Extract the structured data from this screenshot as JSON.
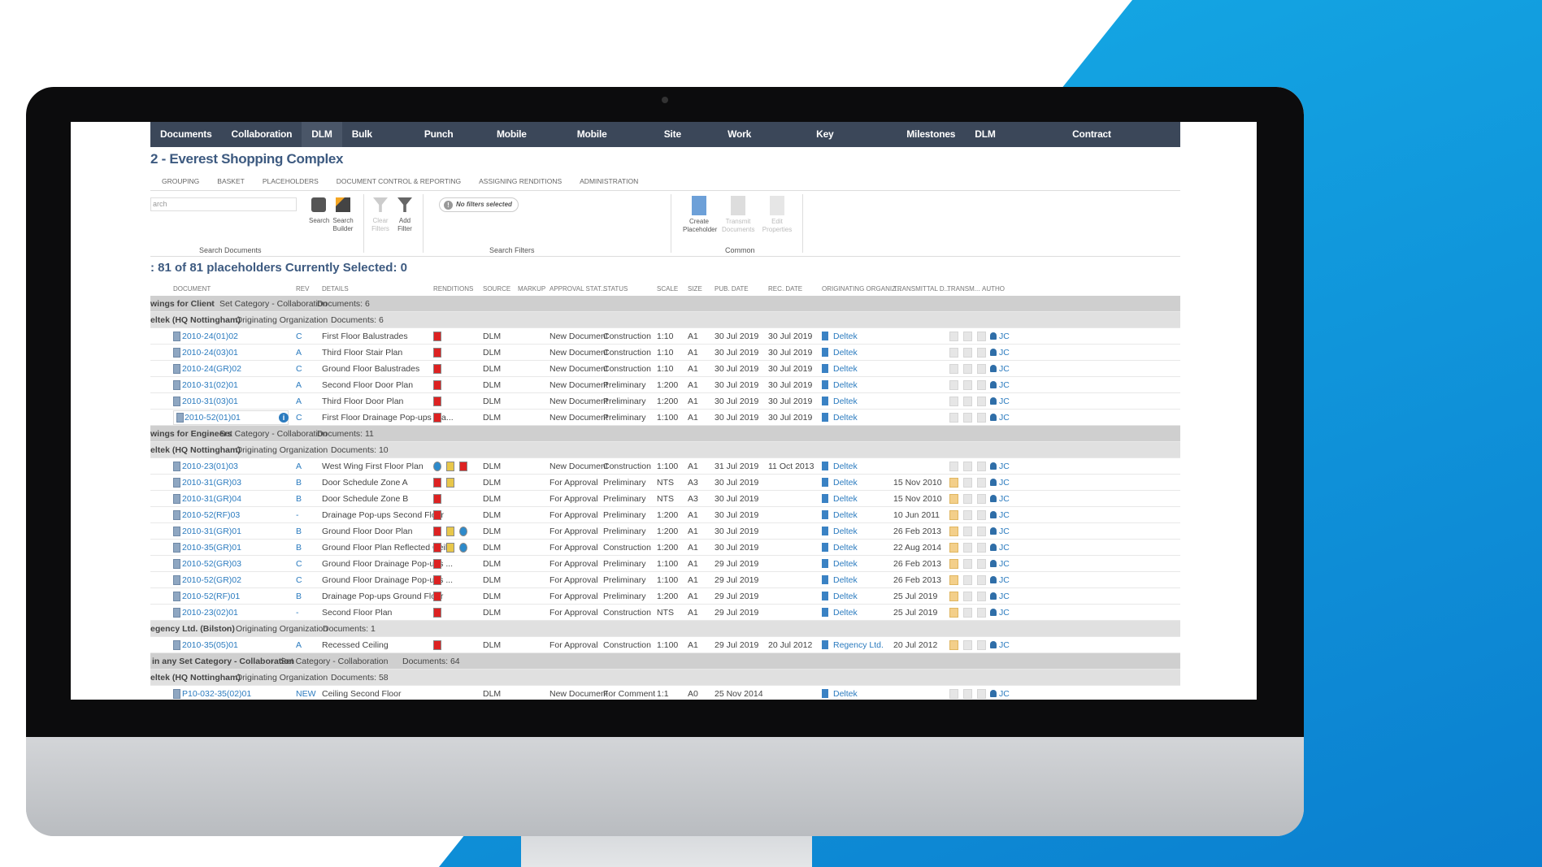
{
  "nav": [
    "Documents",
    "Collaboration",
    "DLM",
    "Bulk Revise",
    "Punch Lists",
    "Mobile Forms",
    "Mobile Reports",
    "Site Visits",
    "Work Packages",
    "Key Documents",
    "Milestones",
    "DLM Transmittals",
    "Contract Management"
  ],
  "nav_active": "DLM",
  "title": "2 - Everest Shopping Complex",
  "subtabs": [
    "GROUPING",
    "BASKET",
    "PLACEHOLDERS",
    "DOCUMENT CONTROL & REPORTING",
    "ASSIGNING RENDITIONS",
    "ADMINISTRATION"
  ],
  "ribbon": {
    "search_placeholder": "arch",
    "search": "Search",
    "search_builder": "Search Builder",
    "clear_filters": "Clear Filters",
    "add_filter": "Add Filter",
    "no_filters": "No filters selected",
    "create_placeholder": "Create Placeholder",
    "transmit_documents": "Transmit Documents",
    "edit_properties": "Edit Properties",
    "group_search": "Search Documents",
    "group_filters": "Search Filters",
    "group_common": "Common"
  },
  "count": ": 81 of 81 placeholders Currently Selected: 0",
  "headers": [
    "DOCUMENT",
    "REV",
    "DETAILS",
    "RENDITIONS",
    "SOURCE",
    "MARKUP",
    "APPROVAL STAT...",
    "STATUS",
    "SCALE",
    "SIZE",
    "PUB. DATE",
    "REC. DATE",
    "ORIGINATING ORGANIZ...",
    "TRANSMITTAL D...",
    "TRANSM...",
    "AUTHO"
  ],
  "colors": {
    "nav": "#3b4759",
    "title": "#3d5a80",
    "link": "#2b7bbf",
    "blue_bg": "#17b3ea"
  },
  "rows": [
    {
      "type": "g1",
      "name": "wings for Client",
      "kind": "Set Category - Collaboration",
      "docs": "Documents: 6"
    },
    {
      "type": "g2",
      "name": "eltek (HQ Nottingham)",
      "kind": "Originating Organization",
      "docs": "Documents: 6"
    },
    {
      "type": "d",
      "doc": "2010-24(01)02",
      "rev": "C",
      "details": "First Floor Balustrades",
      "rend": [
        "pdf"
      ],
      "source": "DLM",
      "approval": "New Document",
      "status": "Construction",
      "scale": "1:10",
      "size": "A1",
      "pub": "30 Jul 2019",
      "rec": "30 Jul 2019",
      "org": "Deltek",
      "trans": "",
      "sent": false,
      "author": "JC"
    },
    {
      "type": "d",
      "doc": "2010-24(03)01",
      "rev": "A",
      "details": "Third Floor Stair Plan",
      "rend": [
        "pdf"
      ],
      "source": "DLM",
      "approval": "New Document",
      "status": "Construction",
      "scale": "1:10",
      "size": "A1",
      "pub": "30 Jul 2019",
      "rec": "30 Jul 2019",
      "org": "Deltek",
      "trans": "",
      "sent": false,
      "author": "JC"
    },
    {
      "type": "d",
      "doc": "2010-24(GR)02",
      "rev": "C",
      "details": "Ground Floor Balustrades",
      "rend": [
        "pdf"
      ],
      "source": "DLM",
      "approval": "New Document",
      "status": "Construction",
      "scale": "1:10",
      "size": "A1",
      "pub": "30 Jul 2019",
      "rec": "30 Jul 2019",
      "org": "Deltek",
      "trans": "",
      "sent": false,
      "author": "JC"
    },
    {
      "type": "d",
      "doc": "2010-31(02)01",
      "rev": "A",
      "details": "Second Floor Door Plan",
      "rend": [
        "pdf"
      ],
      "source": "DLM",
      "approval": "New Document",
      "status": "Preliminary",
      "scale": "1:200",
      "size": "A1",
      "pub": "30 Jul 2019",
      "rec": "30 Jul 2019",
      "org": "Deltek",
      "trans": "",
      "sent": false,
      "author": "JC"
    },
    {
      "type": "d",
      "doc": "2010-31(03)01",
      "rev": "A",
      "details": "Third Floor Door Plan",
      "rend": [
        "pdf"
      ],
      "source": "DLM",
      "approval": "New Document",
      "status": "Preliminary",
      "scale": "1:200",
      "size": "A1",
      "pub": "30 Jul 2019",
      "rec": "30 Jul 2019",
      "org": "Deltek",
      "trans": "",
      "sent": false,
      "author": "JC"
    },
    {
      "type": "d",
      "doc": "2010-52(01)01",
      "rev": "C",
      "details": "First Floor Drainage Pop-ups Pla...",
      "rend": [
        "pdf"
      ],
      "source": "DLM",
      "approval": "New Document",
      "status": "Preliminary",
      "scale": "1:100",
      "size": "A1",
      "pub": "30 Jul 2019",
      "rec": "30 Jul 2019",
      "org": "Deltek",
      "trans": "",
      "sent": false,
      "author": "JC",
      "selected": true
    },
    {
      "type": "g1",
      "name": "wings for Engineers",
      "kind": "Set Category - Collaboration",
      "docs": "Documents: 11"
    },
    {
      "type": "g2",
      "name": "eltek (HQ Nottingham)",
      "kind": "Originating Organization",
      "docs": "Documents: 10"
    },
    {
      "type": "d",
      "doc": "2010-23(01)03",
      "rev": "A",
      "details": "West Wing First Floor Plan",
      "rend": [
        "web",
        "img",
        "pdf"
      ],
      "source": "DLM",
      "approval": "New Document",
      "status": "Construction",
      "scale": "1:100",
      "size": "A1",
      "pub": "31 Jul 2019",
      "rec": "11 Oct 2013",
      "org": "Deltek",
      "trans": "",
      "sent": false,
      "author": "JC"
    },
    {
      "type": "d",
      "doc": "2010-31(GR)03",
      "rev": "B",
      "details": "Door Schedule Zone A",
      "rend": [
        "pdf",
        "img"
      ],
      "source": "DLM",
      "approval": "For Approval",
      "status": "Preliminary",
      "scale": "NTS",
      "size": "A3",
      "pub": "30 Jul 2019",
      "rec": "",
      "org": "Deltek",
      "trans": "15 Nov 2010",
      "sent": true,
      "author": "JC"
    },
    {
      "type": "d",
      "doc": "2010-31(GR)04",
      "rev": "B",
      "details": "Door Schedule Zone B",
      "rend": [
        "pdf"
      ],
      "source": "DLM",
      "approval": "For Approval",
      "status": "Preliminary",
      "scale": "NTS",
      "size": "A3",
      "pub": "30 Jul 2019",
      "rec": "",
      "org": "Deltek",
      "trans": "15 Nov 2010",
      "sent": true,
      "author": "JC"
    },
    {
      "type": "d",
      "doc": "2010-52(RF)03",
      "rev": "-",
      "details": "Drainage Pop-ups Second Floor",
      "rend": [
        "pdf"
      ],
      "source": "DLM",
      "approval": "For Approval",
      "status": "Preliminary",
      "scale": "1:200",
      "size": "A1",
      "pub": "30 Jul 2019",
      "rec": "",
      "org": "Deltek",
      "trans": "10 Jun 2011",
      "sent": true,
      "author": "JC"
    },
    {
      "type": "d",
      "doc": "2010-31(GR)01",
      "rev": "B",
      "details": "Ground Floor Door Plan",
      "rend": [
        "pdf",
        "img",
        "web"
      ],
      "source": "DLM",
      "approval": "For Approval",
      "status": "Preliminary",
      "scale": "1:200",
      "size": "A1",
      "pub": "30 Jul 2019",
      "rec": "",
      "org": "Deltek",
      "trans": "26 Feb 2013",
      "sent": true,
      "author": "JC"
    },
    {
      "type": "d",
      "doc": "2010-35(GR)01",
      "rev": "B",
      "details": "Ground Floor Plan Reflected Ceil...",
      "rend": [
        "pdf",
        "img",
        "web"
      ],
      "source": "DLM",
      "approval": "For Approval",
      "status": "Construction",
      "scale": "1:200",
      "size": "A1",
      "pub": "30 Jul 2019",
      "rec": "",
      "org": "Deltek",
      "trans": "22 Aug 2014",
      "sent": true,
      "author": "JC"
    },
    {
      "type": "d",
      "doc": "2010-52(GR)03",
      "rev": "C",
      "details": "Ground Floor Drainage Pop-ups ...",
      "rend": [
        "pdf"
      ],
      "source": "DLM",
      "approval": "For Approval",
      "status": "Preliminary",
      "scale": "1:100",
      "size": "A1",
      "pub": "29 Jul 2019",
      "rec": "",
      "org": "Deltek",
      "trans": "26 Feb 2013",
      "sent": true,
      "author": "JC"
    },
    {
      "type": "d",
      "doc": "2010-52(GR)02",
      "rev": "C",
      "details": "Ground Floor Drainage Pop-ups ...",
      "rend": [
        "pdf"
      ],
      "source": "DLM",
      "approval": "For Approval",
      "status": "Preliminary",
      "scale": "1:100",
      "size": "A1",
      "pub": "29 Jul 2019",
      "rec": "",
      "org": "Deltek",
      "trans": "26 Feb 2013",
      "sent": true,
      "author": "JC"
    },
    {
      "type": "d",
      "doc": "2010-52(RF)01",
      "rev": "B",
      "details": "Drainage Pop-ups Ground Floor",
      "rend": [
        "pdf"
      ],
      "source": "DLM",
      "approval": "For Approval",
      "status": "Preliminary",
      "scale": "1:200",
      "size": "A1",
      "pub": "29 Jul 2019",
      "rec": "",
      "org": "Deltek",
      "trans": "25 Jul 2019",
      "sent": true,
      "author": "JC"
    },
    {
      "type": "d",
      "doc": "2010-23(02)01",
      "rev": "-",
      "details": "Second Floor Plan",
      "rend": [
        "pdf"
      ],
      "source": "DLM",
      "approval": "For Approval",
      "status": "Construction",
      "scale": "NTS",
      "size": "A1",
      "pub": "29 Jul 2019",
      "rec": "",
      "org": "Deltek",
      "trans": "25 Jul 2019",
      "sent": true,
      "author": "JC"
    },
    {
      "type": "g2",
      "name": "egency Ltd. (Bilston)",
      "kind": "Originating Organization",
      "docs": "Documents: 1"
    },
    {
      "type": "d",
      "doc": "2010-35(05)01",
      "rev": "A",
      "details": "Recessed Ceiling",
      "rend": [
        "pdf"
      ],
      "source": "DLM",
      "approval": "For Approval",
      "status": "Construction",
      "scale": "1:100",
      "size": "A1",
      "pub": "29 Jul 2019",
      "rec": "20 Jul 2012",
      "org": "Regency Ltd.",
      "trans": "20 Jul 2012",
      "sent": true,
      "author": "JC"
    },
    {
      "type": "g1",
      "name": "in any Set Category - Collaboration",
      "kind": "Set Category - Collaboration",
      "docs": "Documents: 64"
    },
    {
      "type": "g2",
      "name": "eltek (HQ Nottingham)",
      "kind": "Originating Organization",
      "docs": "Documents: 58"
    },
    {
      "type": "d",
      "doc": "P10-032-35(02)01",
      "rev": "NEW",
      "details": "Ceiling Second Floor",
      "rend": [],
      "source": "DLM",
      "approval": "New Document",
      "status": "For Comment",
      "scale": "1:1",
      "size": "A0",
      "pub": "25 Nov 2014",
      "rec": "",
      "org": "Deltek",
      "trans": "",
      "sent": false,
      "author": "JC"
    }
  ]
}
